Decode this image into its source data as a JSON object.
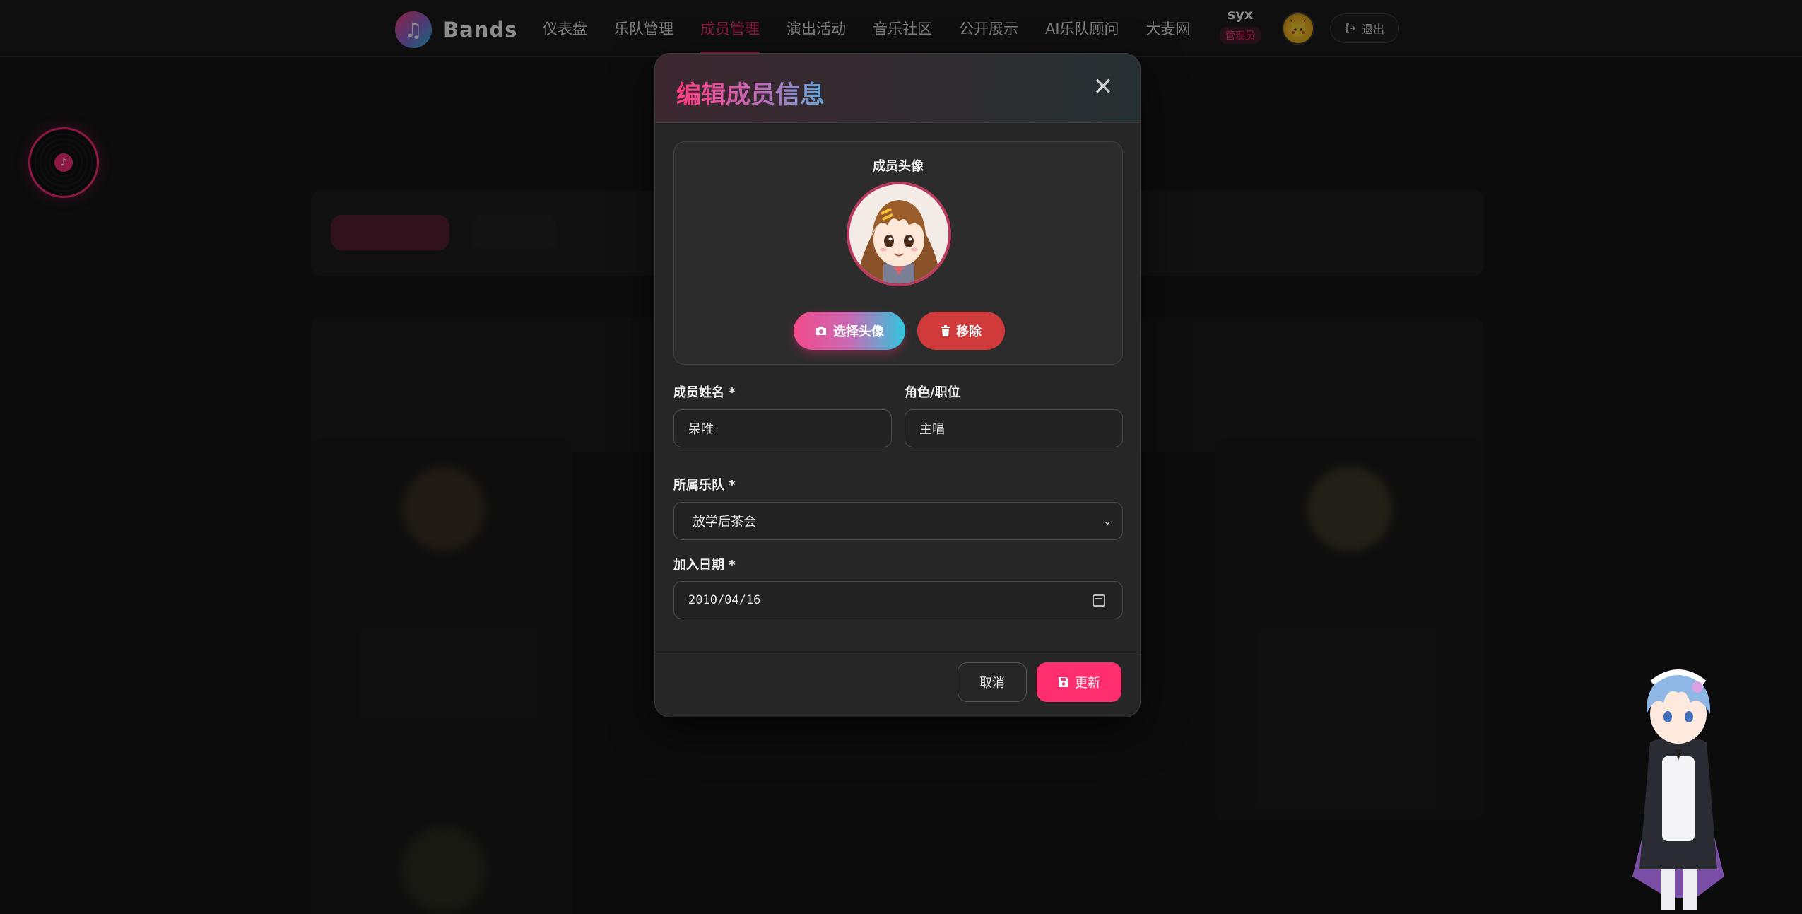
{
  "navbar": {
    "brand_name": "Bands",
    "links": [
      {
        "label": "仪表盘",
        "active": false
      },
      {
        "label": "乐队管理",
        "active": false
      },
      {
        "label": "成员管理",
        "active": true
      },
      {
        "label": "演出活动",
        "active": false
      },
      {
        "label": "音乐社区",
        "active": false
      },
      {
        "label": "公开展示",
        "active": false
      },
      {
        "label": "AI乐队顾问",
        "active": false
      },
      {
        "label": "大麦网",
        "active": false
      }
    ],
    "user": {
      "name": "syx",
      "role": "管理员"
    },
    "logout_label": "退出",
    "accent_color": "#ff2e7e"
  },
  "modal": {
    "title": "编辑成员信息",
    "avatar_section_label": "成员头像",
    "choose_avatar_label": "选择头像",
    "remove_avatar_label": "移除",
    "fields": {
      "name": {
        "label": "成员姓名 *",
        "value": "呆唯"
      },
      "role": {
        "label": "角色/职位",
        "value": "主唱"
      },
      "band": {
        "label": "所属乐队 *",
        "value": "放学后茶会"
      },
      "join_date": {
        "label": "加入日期 *",
        "value": "2010/04/16"
      }
    },
    "cancel_label": "取消",
    "update_label": "更新"
  },
  "icons": [
    "music-note-icon",
    "logout-icon",
    "close-icon",
    "camera-icon",
    "trash-icon",
    "chevron-down-icon",
    "calendar-icon",
    "save-icon"
  ]
}
